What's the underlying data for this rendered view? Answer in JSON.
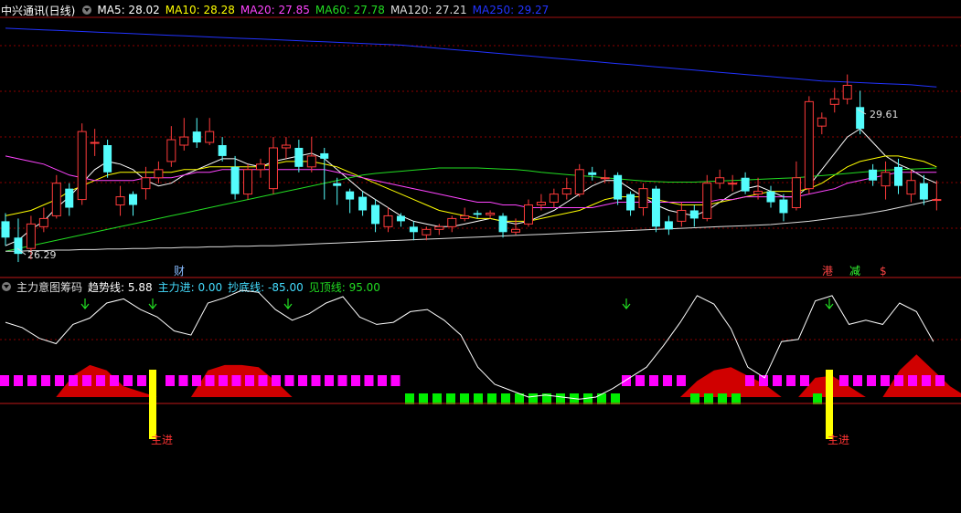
{
  "header": {
    "title": "中兴通讯(日线)",
    "ma": [
      {
        "label": "MA5: 28.02",
        "color": "#ffffff"
      },
      {
        "label": "MA10: 28.28",
        "color": "#ffff00"
      },
      {
        "label": "MA20: 27.85",
        "color": "#ff44ff"
      },
      {
        "label": "MA60: 27.78",
        "color": "#22dd22"
      },
      {
        "label": "MA120: 27.21",
        "color": "#dddddd"
      },
      {
        "label": "MA250: 29.27",
        "color": "#2233ff"
      }
    ]
  },
  "indicator_header": {
    "title": "主力意图筹码",
    "items": [
      {
        "label": "趋势线: 5.88",
        "color": "#ffffff"
      },
      {
        "label": "主力进: 0.00",
        "color": "#44ddff"
      },
      {
        "label": "抄底线: -85.00",
        "color": "#44ddff"
      },
      {
        "label": "见顶线: 95.00",
        "color": "#22dd22"
      }
    ]
  },
  "colors": {
    "up": "#ff3b3b",
    "down": "#54fcfc",
    "grid": "#8b0000",
    "magenta_block": "#ff00ff",
    "green_block": "#00ee00",
    "area": "#d00000",
    "signal": "#ffff00"
  },
  "chart_data": [
    {
      "type": "candlestick",
      "title": "中兴通讯(日线)",
      "y_range": [
        25.9,
        30.5
      ],
      "annotations": {
        "high_label": "29.61",
        "low_label": "26.29",
        "markers": [
          "财",
          "港",
          "减",
          "$"
        ]
      },
      "candles": [
        [
          26.8,
          26.5,
          26.95,
          26.35
        ],
        [
          26.5,
          26.2,
          26.85,
          26.05
        ],
        [
          26.3,
          26.75,
          26.9,
          26.1
        ],
        [
          26.7,
          26.85,
          27.05,
          26.6
        ],
        [
          26.9,
          27.5,
          27.65,
          26.85
        ],
        [
          27.4,
          27.05,
          27.5,
          26.9
        ],
        [
          27.2,
          28.45,
          28.6,
          27.1
        ],
        [
          28.25,
          28.25,
          28.5,
          28.0
        ],
        [
          28.2,
          27.7,
          28.3,
          27.6
        ],
        [
          27.1,
          27.25,
          27.45,
          26.9
        ],
        [
          27.3,
          27.1,
          27.35,
          26.9
        ],
        [
          27.4,
          27.6,
          27.8,
          27.2
        ],
        [
          27.6,
          27.75,
          27.9,
          27.5
        ],
        [
          27.9,
          28.3,
          28.55,
          27.8
        ],
        [
          28.2,
          28.35,
          28.7,
          28.1
        ],
        [
          28.45,
          28.25,
          28.7,
          28.15
        ],
        [
          28.25,
          28.45,
          28.7,
          28.2
        ],
        [
          28.2,
          28.0,
          28.35,
          27.9
        ],
        [
          27.8,
          27.3,
          28.0,
          27.2
        ],
        [
          27.3,
          27.75,
          27.85,
          27.2
        ],
        [
          27.75,
          27.85,
          27.95,
          27.6
        ],
        [
          27.4,
          28.15,
          28.35,
          27.3
        ],
        [
          28.15,
          28.2,
          28.35,
          27.95
        ],
        [
          28.15,
          27.8,
          28.3,
          27.7
        ],
        [
          27.8,
          28.0,
          28.35,
          27.7
        ],
        [
          28.05,
          27.95,
          28.15,
          27.2
        ],
        [
          27.5,
          27.45,
          27.6,
          27.1
        ],
        [
          27.35,
          27.2,
          27.4,
          26.95
        ],
        [
          27.25,
          27.0,
          27.35,
          26.9
        ],
        [
          27.1,
          26.75,
          27.2,
          26.6
        ],
        [
          26.7,
          26.9,
          27.05,
          26.6
        ],
        [
          26.9,
          26.8,
          26.95,
          26.7
        ],
        [
          26.7,
          26.6,
          26.8,
          26.45
        ],
        [
          26.55,
          26.65,
          26.7,
          26.45
        ],
        [
          26.65,
          26.7,
          26.75,
          26.55
        ],
        [
          26.7,
          26.85,
          26.9,
          26.6
        ],
        [
          26.85,
          26.9,
          27.05,
          26.8
        ],
        [
          26.95,
          26.92,
          27.0,
          26.85
        ],
        [
          26.92,
          26.95,
          27.0,
          26.85
        ],
        [
          26.9,
          26.6,
          26.95,
          26.5
        ],
        [
          26.6,
          26.65,
          26.85,
          26.55
        ],
        [
          26.75,
          27.1,
          27.2,
          26.7
        ],
        [
          27.1,
          27.15,
          27.3,
          27.0
        ],
        [
          27.15,
          27.3,
          27.4,
          27.05
        ],
        [
          27.3,
          27.4,
          27.6,
          27.2
        ],
        [
          27.3,
          27.75,
          27.85,
          27.25
        ],
        [
          27.7,
          27.65,
          27.8,
          27.55
        ],
        [
          27.6,
          27.6,
          27.75,
          27.5
        ],
        [
          27.65,
          27.2,
          27.7,
          27.1
        ],
        [
          27.3,
          27.0,
          27.35,
          26.9
        ],
        [
          27.05,
          27.4,
          27.5,
          26.9
        ],
        [
          27.4,
          26.7,
          27.45,
          26.6
        ],
        [
          26.8,
          26.65,
          26.9,
          26.55
        ],
        [
          26.8,
          27.0,
          27.15,
          26.7
        ],
        [
          27.0,
          26.85,
          27.1,
          26.7
        ],
        [
          26.85,
          27.5,
          27.65,
          26.8
        ],
        [
          27.5,
          27.6,
          27.75,
          27.4
        ],
        [
          27.5,
          27.5,
          27.65,
          27.35
        ],
        [
          27.6,
          27.35,
          27.7,
          27.3
        ],
        [
          27.3,
          27.35,
          27.6,
          27.2
        ],
        [
          27.35,
          27.15,
          27.45,
          27.05
        ],
        [
          27.2,
          26.95,
          27.3,
          26.8
        ],
        [
          27.05,
          27.6,
          27.9,
          27.0
        ],
        [
          27.4,
          29.0,
          29.1,
          27.3
        ],
        [
          28.55,
          28.7,
          28.8,
          28.4
        ],
        [
          28.95,
          29.05,
          29.25,
          28.8
        ],
        [
          29.05,
          29.3,
          29.5,
          28.95
        ],
        [
          28.9,
          28.5,
          29.2,
          28.4
        ],
        [
          27.75,
          27.55,
          27.85,
          27.45
        ],
        [
          27.45,
          27.7,
          27.9,
          27.2
        ],
        [
          27.8,
          27.45,
          27.95,
          27.3
        ],
        [
          27.3,
          27.55,
          27.75,
          27.15
        ],
        [
          27.5,
          27.2,
          27.65,
          27.1
        ],
        [
          27.2,
          27.2,
          27.55,
          27.0
        ]
      ],
      "ma_lines": [
        {
          "name": "MA5",
          "color": "#ffffff",
          "values": [
            26.35,
            26.45,
            26.65,
            26.8,
            27.05,
            27.25,
            27.5,
            27.75,
            27.9,
            27.85,
            27.75,
            27.55,
            27.45,
            27.5,
            27.65,
            27.75,
            27.85,
            27.95,
            27.95,
            27.85,
            27.8,
            27.9,
            27.95,
            28.0,
            28.05,
            27.95,
            27.75,
            27.55,
            27.35,
            27.2,
            27.05,
            26.9,
            26.8,
            26.75,
            26.7,
            26.7,
            26.75,
            26.8,
            26.85,
            26.8,
            26.75,
            26.8,
            26.9,
            27.0,
            27.15,
            27.3,
            27.45,
            27.55,
            27.55,
            27.4,
            27.25,
            27.1,
            27.0,
            26.95,
            26.9,
            27.0,
            27.15,
            27.3,
            27.4,
            27.45,
            27.35,
            27.25,
            27.25,
            27.45,
            27.75,
            28.05,
            28.35,
            28.5,
            28.25,
            28.0,
            27.85,
            27.75,
            27.6,
            27.5
          ]
        },
        {
          "name": "MA10",
          "color": "#ffff00",
          "values": [
            26.9,
            26.95,
            27.0,
            27.1,
            27.2,
            27.35,
            27.45,
            27.55,
            27.65,
            27.7,
            27.7,
            27.7,
            27.7,
            27.7,
            27.75,
            27.75,
            27.8,
            27.8,
            27.8,
            27.8,
            27.8,
            27.85,
            27.9,
            27.9,
            27.9,
            27.85,
            27.8,
            27.7,
            27.6,
            27.5,
            27.4,
            27.3,
            27.2,
            27.1,
            27.0,
            26.95,
            26.9,
            26.85,
            26.85,
            26.8,
            26.8,
            26.8,
            26.85,
            26.9,
            26.95,
            27.0,
            27.1,
            27.2,
            27.25,
            27.25,
            27.25,
            27.2,
            27.15,
            27.1,
            27.1,
            27.1,
            27.15,
            27.2,
            27.25,
            27.3,
            27.35,
            27.35,
            27.35,
            27.4,
            27.5,
            27.65,
            27.8,
            27.9,
            27.95,
            28.0,
            28.0,
            27.95,
            27.9,
            27.8
          ]
        },
        {
          "name": "MA20",
          "color": "#ff44ff",
          "values": [
            28.0,
            27.95,
            27.9,
            27.85,
            27.75,
            27.65,
            27.6,
            27.55,
            27.55,
            27.55,
            27.55,
            27.6,
            27.6,
            27.6,
            27.65,
            27.7,
            27.7,
            27.75,
            27.75,
            27.75,
            27.75,
            27.75,
            27.75,
            27.75,
            27.75,
            27.75,
            27.7,
            27.65,
            27.6,
            27.55,
            27.5,
            27.45,
            27.4,
            27.35,
            27.3,
            27.25,
            27.2,
            27.15,
            27.15,
            27.1,
            27.1,
            27.05,
            27.05,
            27.05,
            27.05,
            27.05,
            27.05,
            27.1,
            27.15,
            27.15,
            27.15,
            27.15,
            27.15,
            27.15,
            27.15,
            27.15,
            27.2,
            27.2,
            27.25,
            27.25,
            27.25,
            27.25,
            27.25,
            27.3,
            27.35,
            27.4,
            27.5,
            27.55,
            27.6,
            27.65,
            27.7,
            27.7,
            27.7,
            27.7
          ]
        },
        {
          "name": "MA60",
          "color": "#22dd22",
          "values": [
            26.25,
            26.3,
            26.35,
            26.4,
            26.45,
            26.5,
            26.55,
            26.6,
            26.65,
            26.7,
            26.75,
            26.8,
            26.85,
            26.9,
            26.95,
            27.0,
            27.05,
            27.1,
            27.15,
            27.2,
            27.25,
            27.3,
            27.35,
            27.4,
            27.45,
            27.5,
            27.55,
            27.6,
            27.65,
            27.68,
            27.7,
            27.72,
            27.74,
            27.76,
            27.78,
            27.78,
            27.78,
            27.78,
            27.77,
            27.76,
            27.75,
            27.73,
            27.7,
            27.68,
            27.66,
            27.64,
            27.62,
            27.6,
            27.58,
            27.56,
            27.54,
            27.53,
            27.52,
            27.52,
            27.52,
            27.53,
            27.54,
            27.55,
            27.56,
            27.57,
            27.58,
            27.59,
            27.6,
            27.62,
            27.64,
            27.66,
            27.68,
            27.7,
            27.72,
            27.74,
            27.75,
            27.76,
            27.77,
            27.78
          ]
        },
        {
          "name": "MA120",
          "color": "#dddddd",
          "values": [
            26.25,
            26.25,
            26.26,
            26.26,
            26.27,
            26.27,
            26.28,
            26.28,
            26.29,
            26.29,
            26.3,
            26.3,
            26.31,
            26.31,
            26.32,
            26.32,
            26.33,
            26.33,
            26.34,
            26.34,
            26.35,
            26.35,
            26.36,
            26.37,
            26.38,
            26.39,
            26.4,
            26.41,
            26.42,
            26.43,
            26.44,
            26.45,
            26.46,
            26.47,
            26.48,
            26.49,
            26.5,
            26.51,
            26.52,
            26.53,
            26.54,
            26.55,
            26.56,
            26.57,
            26.58,
            26.59,
            26.6,
            26.61,
            26.62,
            26.63,
            26.64,
            26.65,
            26.66,
            26.67,
            26.68,
            26.69,
            26.7,
            26.71,
            26.72,
            26.73,
            26.74,
            26.76,
            26.78,
            26.8,
            26.83,
            26.86,
            26.89,
            26.92,
            26.96,
            27.0,
            27.05,
            27.1,
            27.15,
            27.21
          ]
        },
        {
          "name": "MA250",
          "color": "#2233ff",
          "values": [
            30.35,
            30.34,
            30.33,
            30.32,
            30.31,
            30.3,
            30.29,
            30.28,
            30.27,
            30.26,
            30.25,
            30.24,
            30.23,
            30.22,
            30.21,
            30.2,
            30.19,
            30.18,
            30.17,
            30.16,
            30.15,
            30.14,
            30.13,
            30.12,
            30.11,
            30.1,
            30.09,
            30.08,
            30.07,
            30.06,
            30.05,
            30.04,
            30.02,
            30.0,
            29.98,
            29.96,
            29.94,
            29.92,
            29.9,
            29.88,
            29.86,
            29.84,
            29.82,
            29.8,
            29.78,
            29.76,
            29.74,
            29.72,
            29.7,
            29.68,
            29.66,
            29.64,
            29.62,
            29.6,
            29.58,
            29.56,
            29.54,
            29.52,
            29.5,
            29.48,
            29.46,
            29.44,
            29.42,
            29.4,
            29.38,
            29.37,
            29.36,
            29.35,
            29.34,
            29.33,
            29.32,
            29.31,
            29.29,
            29.27
          ]
        }
      ]
    },
    {
      "type": "line",
      "title": "主力意图筹码",
      "y_range": [
        -100,
        100
      ],
      "trend": [
        70,
        65,
        55,
        50,
        68,
        74,
        88,
        92,
        82,
        75,
        62,
        58,
        88,
        93,
        100,
        98,
        82,
        72,
        78,
        88,
        94,
        75,
        68,
        70,
        80,
        82,
        72,
        58,
        28,
        12,
        6,
        0,
        2,
        0,
        -2,
        0,
        8,
        18,
        28,
        48,
        70,
        95,
        87,
        64,
        28,
        18,
        52,
        54,
        90,
        95,
        68,
        72,
        68,
        88,
        80,
        52
      ],
      "area": [
        0,
        0,
        0,
        0,
        20,
        30,
        25,
        10,
        5,
        0,
        0,
        0,
        25,
        30,
        30,
        28,
        15,
        0,
        0,
        0,
        0,
        0,
        0,
        0,
        0,
        0,
        0,
        0,
        0,
        0,
        0,
        0,
        0,
        0,
        0,
        0,
        0,
        0,
        0,
        0,
        0,
        15,
        25,
        28,
        20,
        12,
        0,
        0,
        18,
        20,
        10,
        0,
        0,
        25,
        40,
        25,
        10,
        0
      ]
    }
  ],
  "signal_labels": [
    "主进",
    "主进"
  ]
}
